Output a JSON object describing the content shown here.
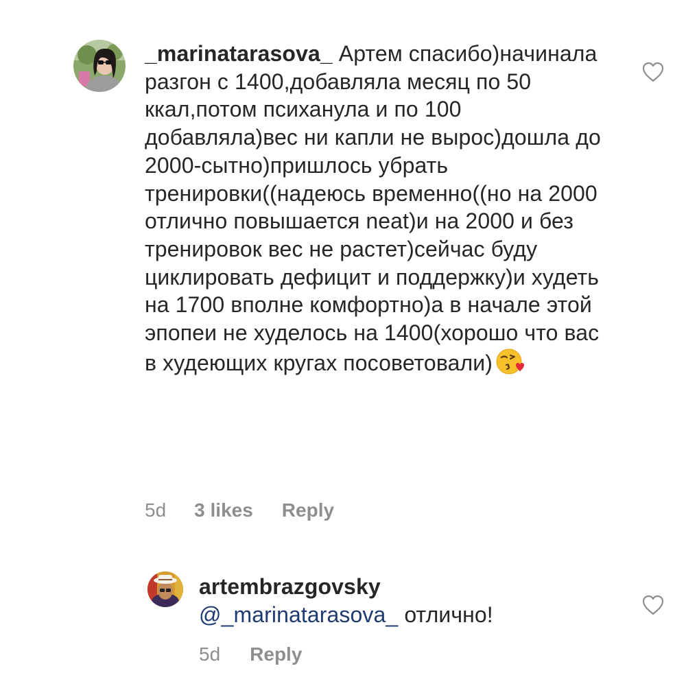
{
  "comments": [
    {
      "username": "_marinatarasova_",
      "text": "Артем спасибо)начинала разгон с 1400,добавляла месяц по 50 ккал,потом психанула и по 100 добавляла)вес ни капли не вырос)дошла до 2000-сытно)пришлось убрать тренировки((надеюсь временно((но на 2000 отлично повышается neat)и на 2000 и без тренировок вес не растет)сейчас буду циклировать дефицит и поддержку)и худеть на 1700 вполне комфортно)а в начале этой эпопеи не худелось на 1400(хорошо что вас в худеющих кругах посоветовали)",
      "emoji": "kissing-face-with-heart",
      "age": "5d",
      "likes": "3 likes",
      "reply_label": "Reply",
      "heart_icon": "heart-outline-icon"
    },
    {
      "username": "artembrazgovsky",
      "mention": "@_marinatarasova_",
      "text": "отлично!",
      "age": "5d",
      "reply_label": "Reply",
      "heart_icon": "heart-outline-icon"
    }
  ],
  "colors": {
    "text": "#262626",
    "secondary": "#8e8e8e",
    "mention": "#1e3a70",
    "background": "#ffffff"
  }
}
